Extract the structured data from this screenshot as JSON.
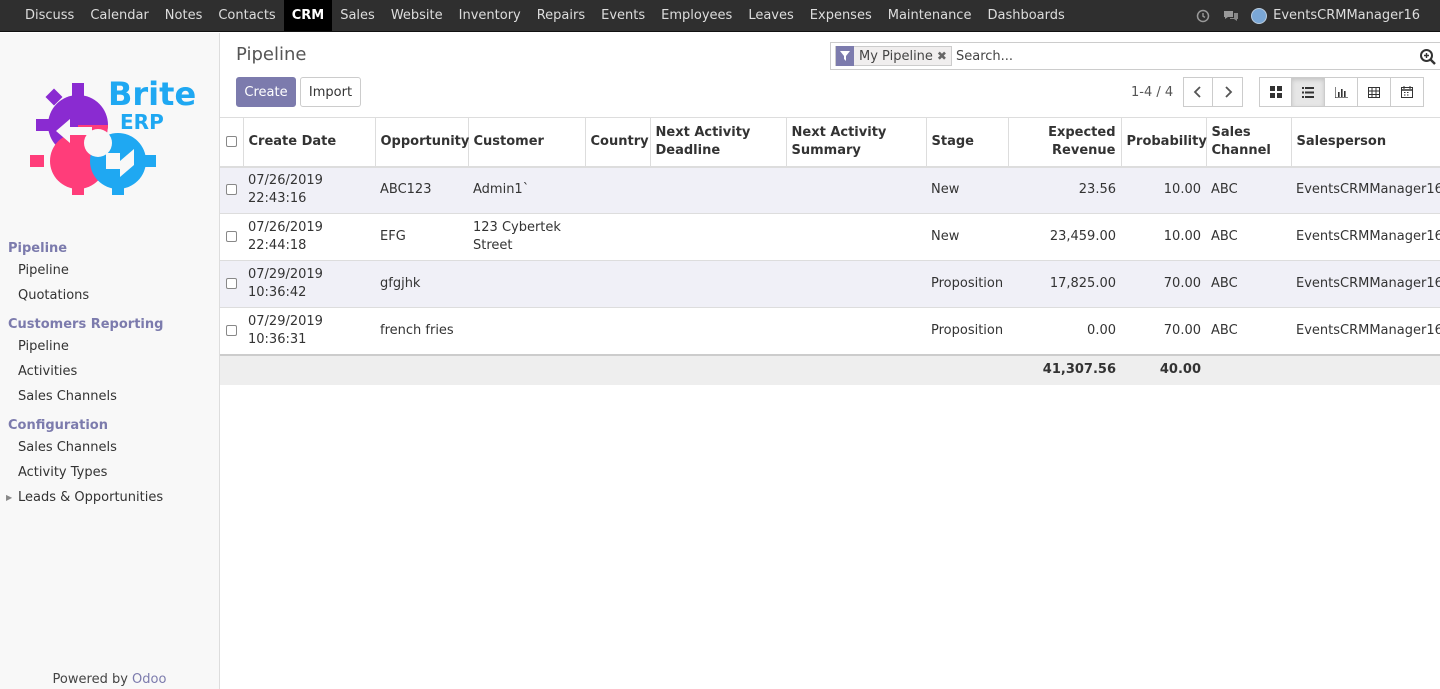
{
  "topbar": {
    "menu": [
      "Discuss",
      "Calendar",
      "Notes",
      "Contacts",
      "CRM",
      "Sales",
      "Website",
      "Inventory",
      "Repairs",
      "Events",
      "Employees",
      "Leaves",
      "Expenses",
      "Maintenance",
      "Dashboards"
    ],
    "active_menu": "CRM",
    "user_name": "EventsCRMManager16"
  },
  "sidebar": {
    "logo_text_top": "Brite",
    "logo_text_bottom": "ERP",
    "sections": [
      {
        "header": "Pipeline",
        "items": [
          "Pipeline",
          "Quotations"
        ]
      },
      {
        "header": "Customers Reporting",
        "items": [
          "Pipeline",
          "Activities",
          "Sales Channels"
        ]
      },
      {
        "header": "Configuration",
        "items": [
          "Sales Channels",
          "Activity Types",
          "Leads & Opportunities"
        ]
      }
    ],
    "powered_by": "Powered by",
    "powered_brand": "Odoo"
  },
  "control_panel": {
    "breadcrumb": "Pipeline",
    "create_label": "Create",
    "import_label": "Import",
    "search": {
      "facet_label": "My Pipeline",
      "placeholder": "Search..."
    },
    "pager": "1-4 / 4"
  },
  "table": {
    "columns": [
      "Create Date",
      "Opportunity",
      "Customer",
      "Country",
      "Next Activity Deadline",
      "Next Activity Summary",
      "Stage",
      "Expected Revenue",
      "Probability",
      "Sales Channel",
      "Salesperson"
    ],
    "rows": [
      {
        "create_date": "07/26/2019 22:43:16",
        "opportunity": "ABC123",
        "customer": "Admin1`",
        "country": "",
        "deadline": "",
        "summary": "",
        "stage": "New",
        "revenue": "23.56",
        "probability": "10.00",
        "channel": "ABC",
        "salesperson": "EventsCRMManager16"
      },
      {
        "create_date": "07/26/2019 22:44:18",
        "opportunity": "EFG",
        "customer": "123 Cybertek Street",
        "country": "",
        "deadline": "",
        "summary": "",
        "stage": "New",
        "revenue": "23,459.00",
        "probability": "10.00",
        "channel": "ABC",
        "salesperson": "EventsCRMManager16"
      },
      {
        "create_date": "07/29/2019 10:36:42",
        "opportunity": "gfgjhk",
        "customer": "",
        "country": "",
        "deadline": "",
        "summary": "",
        "stage": "Proposition",
        "revenue": "17,825.00",
        "probability": "70.00",
        "channel": "ABC",
        "salesperson": "EventsCRMManager16"
      },
      {
        "create_date": "07/29/2019 10:36:31",
        "opportunity": "french fries",
        "customer": "",
        "country": "",
        "deadline": "",
        "summary": "",
        "stage": "Proposition",
        "revenue": "0.00",
        "probability": "70.00",
        "channel": "ABC",
        "salesperson": "EventsCRMManager16"
      }
    ],
    "totals": {
      "revenue": "41,307.56",
      "probability": "40.00"
    }
  },
  "colors": {
    "brand": "#7c7bad",
    "navbar": "#2f2f2f"
  }
}
